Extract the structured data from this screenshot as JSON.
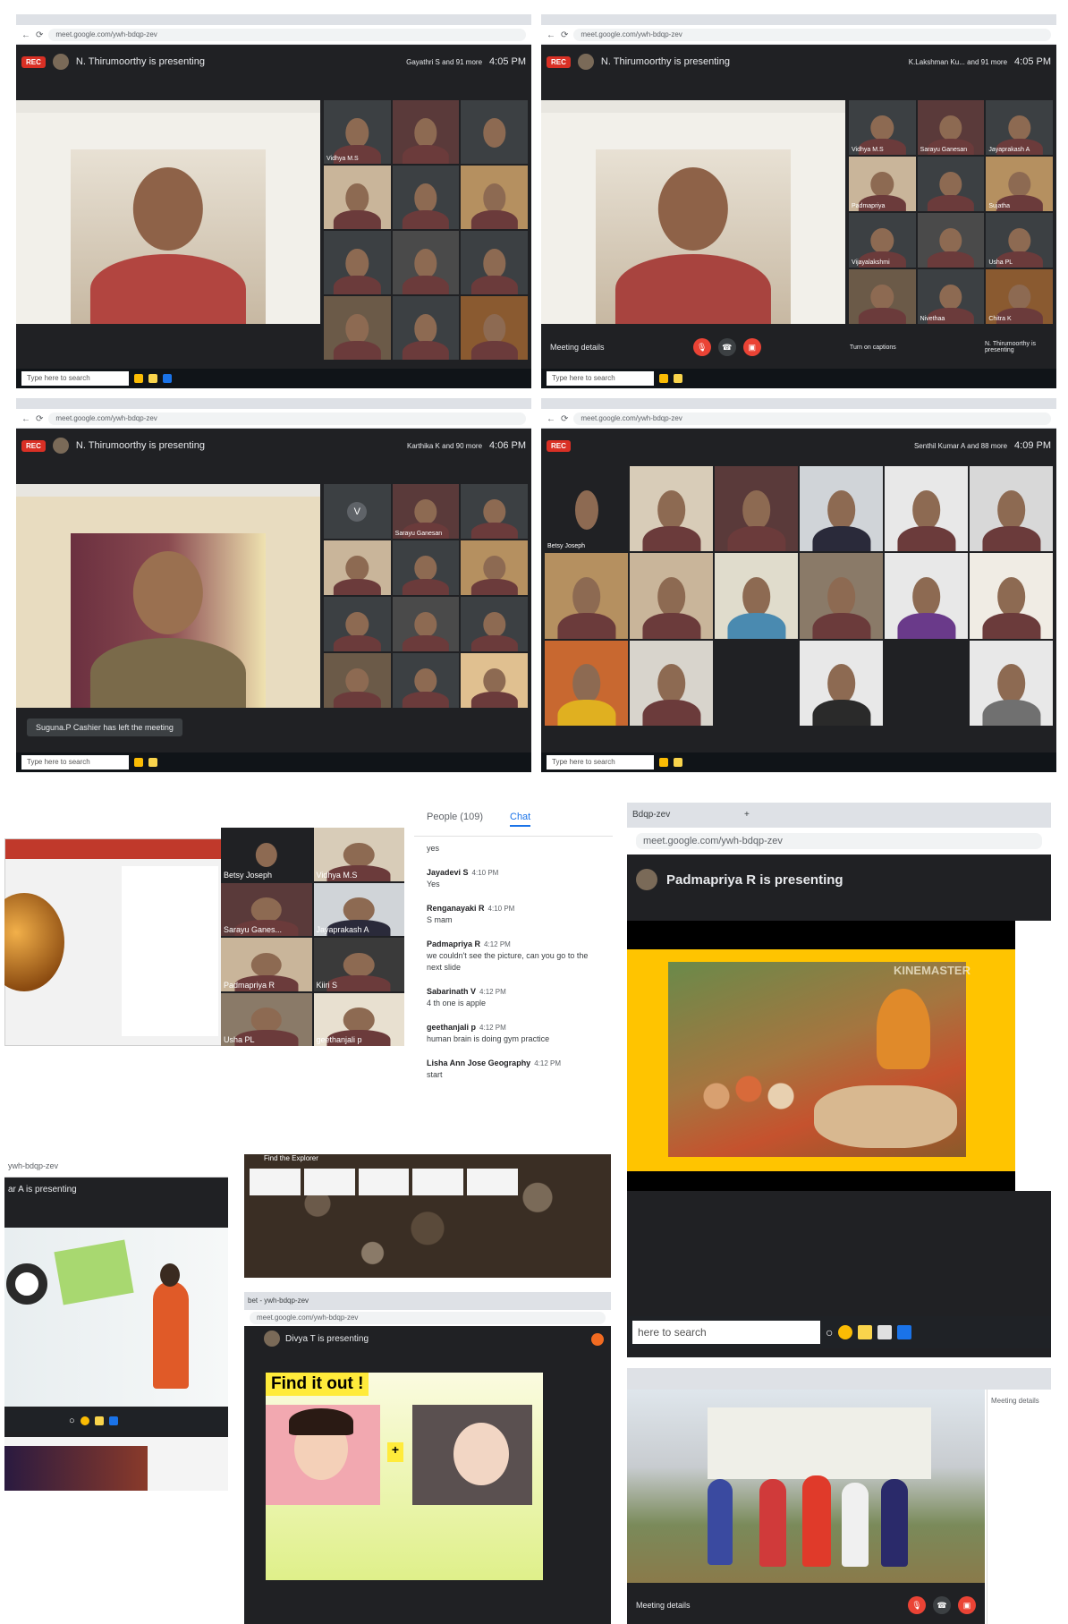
{
  "meet_common": {
    "url": "meet.google.com/ywh-bdqp-zev",
    "rec_label": "REC",
    "taskbar_search": "Type here to search"
  },
  "panel1": {
    "presenting": "N. Thirumoorthy is presenting",
    "participants": "Gayathri S and 91 more",
    "time": "4:05 PM",
    "tiles": [
      "Vidhya M.S",
      "",
      "",
      "",
      "",
      "",
      "",
      "",
      "",
      "",
      "",
      ""
    ]
  },
  "panel2": {
    "presenting": "N. Thirumoorthy is presenting",
    "participants": "K.Lakshman Ku... and 91 more",
    "time": "4:05 PM",
    "meeting_details": "Meeting details",
    "captions": "Turn on captions",
    "presenter_note": "N. Thirumoorthy is presenting",
    "tiles": [
      "Vidhya M.S",
      "Sarayu Ganesan",
      "Jayaprakash A",
      "Padmapriya",
      "",
      "Sujatha",
      "Vijayalakshmi",
      "",
      "Usha PL",
      "",
      "Nivethaa",
      "Chitra K"
    ]
  },
  "panel3": {
    "presenting": "N. Thirumoorthy is presenting",
    "participants": "Karthika K and 90 more",
    "time": "4:06 PM",
    "toast": "Suguna.P Cashier has left the meeting",
    "tiles": [
      "V",
      "Sarayu Ganesan",
      "",
      "",
      "",
      "",
      "",
      "",
      "",
      "",
      "",
      ""
    ]
  },
  "panel4": {
    "participants": "Senthil Kumar A and 88 more",
    "time": "4:09 PM",
    "first_tile": "Betsy Joseph",
    "tiles": [
      "Betsy Joseph",
      "",
      "",
      "",
      "",
      "",
      "",
      "",
      "",
      "",
      "",
      "",
      "",
      "",
      "",
      "",
      "",
      ""
    ]
  },
  "panel5": {
    "tiles": [
      "Betsy Joseph",
      "Vidhya M.S",
      "Sarayu Ganes...",
      "Jayaprakash A",
      "Padmapriya R",
      "Kiiri S",
      "Usha PL",
      "geethanjali p"
    ]
  },
  "chat": {
    "people_tab": "People (109)",
    "chat_tab": "Chat",
    "messages": [
      {
        "sender": "",
        "time": "",
        "text": "yes"
      },
      {
        "sender": "Jayadevi S",
        "time": "4:10 PM",
        "text": "Yes"
      },
      {
        "sender": "Renganayaki R",
        "time": "4:10 PM",
        "text": "S mam"
      },
      {
        "sender": "Padmapriya R",
        "time": "4:12 PM",
        "text": "we couldn't see the picture, can you go to the next slide"
      },
      {
        "sender": "Sabarinath V",
        "time": "4:12 PM",
        "text": "4 th one is apple"
      },
      {
        "sender": "geethanjali p",
        "time": "4:12 PM",
        "text": "human brain is doing gym practice"
      },
      {
        "sender": "Lisha Ann Jose Geography",
        "time": "4:12 PM",
        "text": "start"
      }
    ]
  },
  "panel_padma": {
    "tab_text": "Bdqp-zev",
    "url": "meet.google.com/ywh-bdqp-zev",
    "presenting": "Padmapriya R is presenting",
    "watermark": "KINEMASTER",
    "taskbar_search": "here to search"
  },
  "panel_ar": {
    "tab_text": "ywh-bdqp-zev",
    "presenting": "ar A is presenting"
  },
  "panel_pebble": {
    "title": "Find the Explorer"
  },
  "panel_divya": {
    "tab_text": "bet - ywh-bdqp-zev",
    "url": "meet.google.com/ywh-bdqp-zev",
    "presenting": "Divya T is presenting",
    "slide_title": "Find it out !",
    "plus": "+"
  },
  "panel_dance": {
    "meeting_details": "Meeting details"
  },
  "colors": {
    "meet_dark": "#202124",
    "rec_red": "#d93025",
    "chat_blue": "#1a73e8",
    "painting_frame": "#ffc400"
  }
}
